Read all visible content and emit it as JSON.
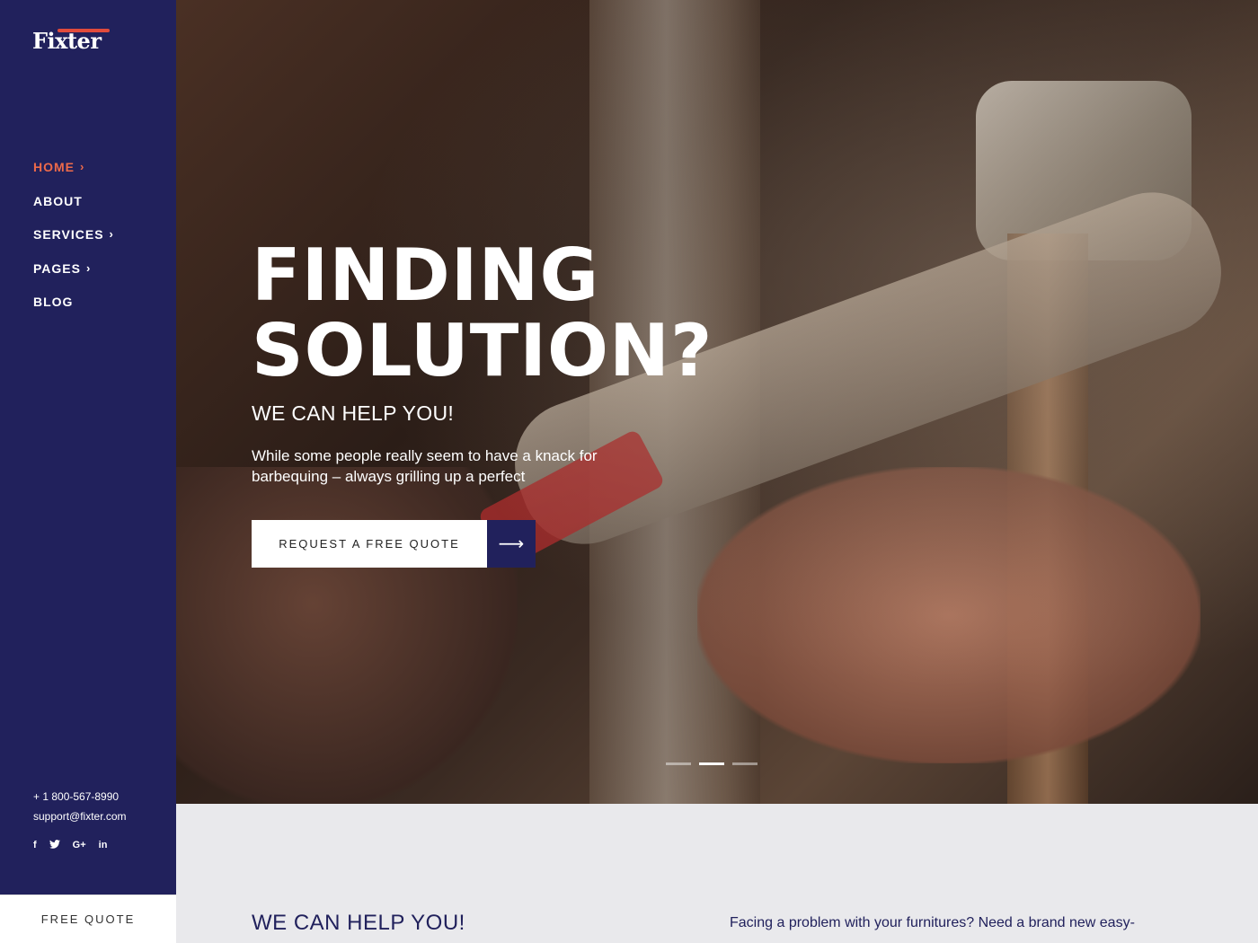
{
  "brand": {
    "name": "Fixter",
    "accent": "#ee6a4a",
    "navy": "#21215c"
  },
  "nav": {
    "items": [
      {
        "label": "HOME",
        "active": true,
        "has_submenu": true
      },
      {
        "label": "ABOUT",
        "active": false,
        "has_submenu": false
      },
      {
        "label": "SERVICES",
        "active": false,
        "has_submenu": true
      },
      {
        "label": "PAGES",
        "active": false,
        "has_submenu": true
      },
      {
        "label": "BLOG",
        "active": false,
        "has_submenu": false
      }
    ],
    "submenu_glyph": "›"
  },
  "contact": {
    "phone": "+ 1 800-567-8990",
    "email": "support@fixter.com"
  },
  "social": {
    "facebook": "f",
    "twitter": "🐦",
    "googleplus": "G+",
    "linkedin": "in"
  },
  "free_quote_label": "FREE QUOTE",
  "hero": {
    "title_line1": "FINDING",
    "title_line2": "SOLUTION?",
    "subtitle": "WE CAN HELP YOU!",
    "desc_line1": "While some people really seem to have a knack for",
    "desc_line2": "barbequing – always grilling up a perfect",
    "cta_label": "REQUEST A FREE QUOTE",
    "cta_arrow": "⟶",
    "slides": 3,
    "active_slide": 2
  },
  "intro": {
    "title": "WE CAN HELP YOU!",
    "text": "Facing a problem with your furnitures? Need a brand new easy-"
  }
}
